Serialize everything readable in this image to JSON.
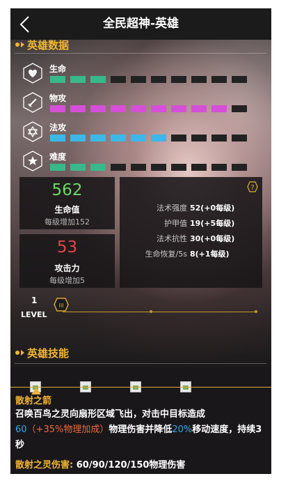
{
  "header": {
    "title": "全民超神-英雄"
  },
  "hero_data": {
    "section_title": "英雄数据",
    "stats": [
      {
        "label": "生命",
        "icon": "heart-icon",
        "filled": 3,
        "total": 10,
        "color": "#37b98c"
      },
      {
        "label": "物攻",
        "icon": "sword-icon",
        "filled": 9,
        "total": 10,
        "color": "#d64fd9"
      },
      {
        "label": "法攻",
        "icon": "star-of-david-icon",
        "filled": 6,
        "total": 10,
        "color": "#3bb8e8"
      },
      {
        "label": "难度",
        "icon": "star-icon",
        "filled": 3,
        "total": 10,
        "color": "#37b98c"
      }
    ]
  },
  "cards": {
    "hp": {
      "value": "562",
      "label": "生命值",
      "sub": "每级增加152",
      "color": "#6cd864"
    },
    "atk": {
      "value": "53",
      "label": "攻击力",
      "sub": "每级增加5",
      "color": "#e84444"
    }
  },
  "attributes": [
    {
      "name": "法术强度",
      "value": "52(+0每级)"
    },
    {
      "name": "护甲值",
      "value": "19(+5每级)"
    },
    {
      "name": "法术抗性",
      "value": "30(+0每级)"
    },
    {
      "name": "生命恢复/5s",
      "value": "8(+1每级)"
    }
  ],
  "level": {
    "value": "1",
    "label": "LEVEL",
    "knob_label": "III",
    "fraction": 0
  },
  "skills": {
    "section_title": "英雄技能",
    "tab_count": 4,
    "selected_index": 0,
    "name": "散射之箭",
    "desc_1": "召唤百鸟之灵向扇形区域飞出，对击中目标造成",
    "desc_num": "60",
    "desc_bonus": "（+35%物理加成）",
    "desc_2": "物理伤害并降低",
    "desc_pct": "20%",
    "desc_3": "移动速度，持续3秒",
    "dmg_label": "散射之灵伤害:",
    "dmg_value": " 60/90/120/150物理伤害"
  },
  "colors": {
    "accent": "#f2b630",
    "bar_empty": "#222222"
  }
}
